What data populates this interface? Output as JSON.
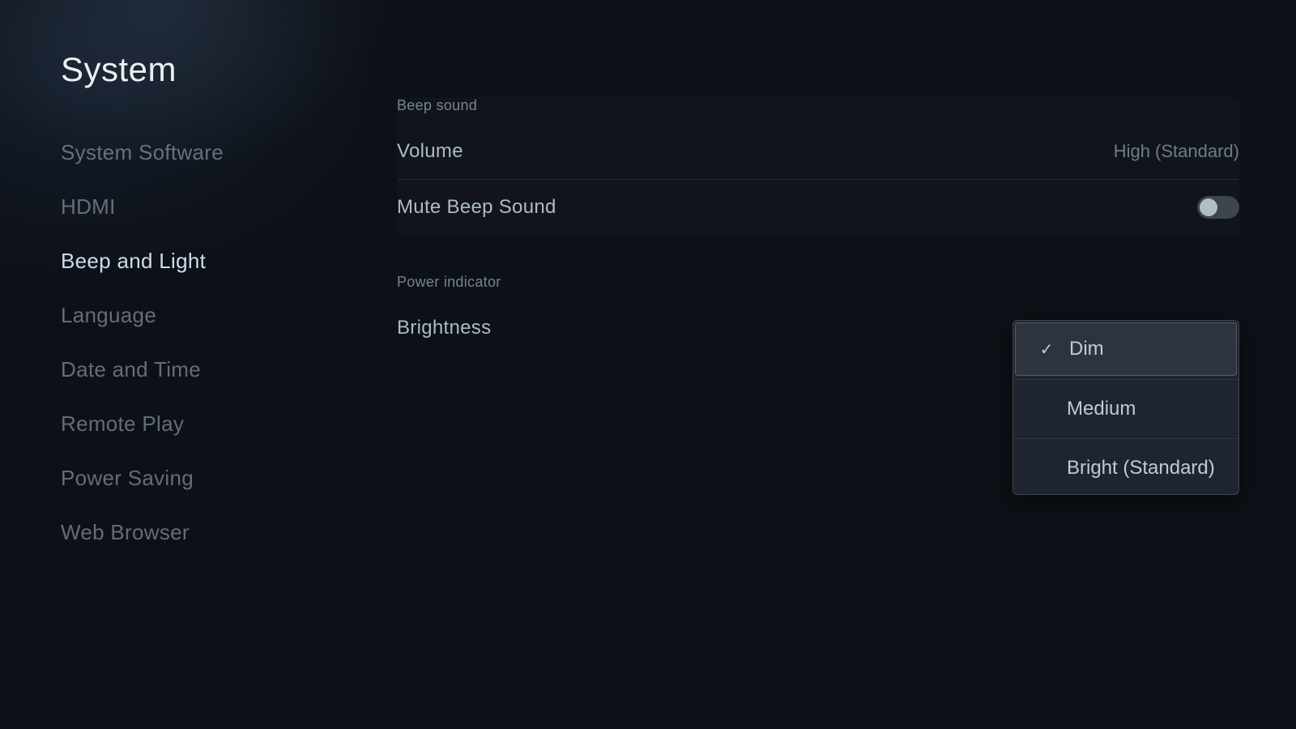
{
  "page": {
    "title": "System"
  },
  "sidebar": {
    "items": [
      {
        "id": "system-software",
        "label": "System Software",
        "active": false
      },
      {
        "id": "hdmi",
        "label": "HDMI",
        "active": false
      },
      {
        "id": "beep-and-light",
        "label": "Beep and Light",
        "active": true
      },
      {
        "id": "language",
        "label": "Language",
        "active": false
      },
      {
        "id": "date-and-time",
        "label": "Date and Time",
        "active": false
      },
      {
        "id": "remote-play",
        "label": "Remote Play",
        "active": false
      },
      {
        "id": "power-saving",
        "label": "Power Saving",
        "active": false
      },
      {
        "id": "web-browser",
        "label": "Web Browser",
        "active": false
      }
    ]
  },
  "beep_sound": {
    "section_label": "Beep sound",
    "volume": {
      "name": "Volume",
      "value": "High (Standard)"
    },
    "mute": {
      "name": "Mute Beep Sound",
      "enabled": false
    }
  },
  "power_indicator": {
    "section_label": "Power indicator",
    "brightness": {
      "name": "Brightness"
    },
    "dropdown": {
      "options": [
        {
          "id": "dim",
          "label": "Dim",
          "selected": true
        },
        {
          "id": "medium",
          "label": "Medium",
          "selected": false
        },
        {
          "id": "bright-standard",
          "label": "Bright (Standard)",
          "selected": false
        }
      ]
    }
  },
  "icons": {
    "checkmark": "✓"
  }
}
